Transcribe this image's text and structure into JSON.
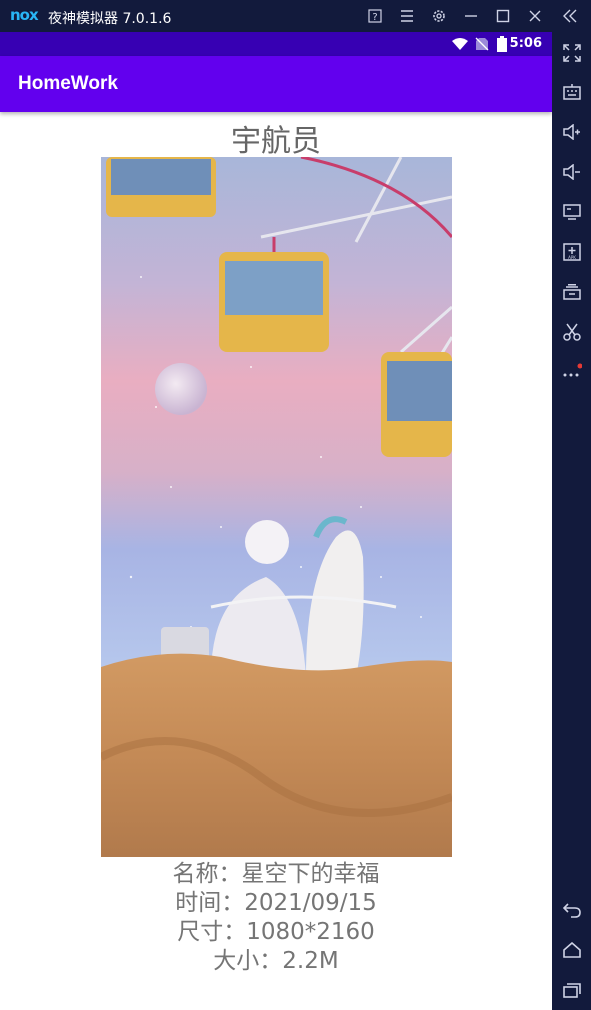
{
  "window": {
    "logo": "nox",
    "title": "夜神模拟器 7.0.1.6",
    "controls": [
      "help-icon",
      "menu-icon",
      "settings-icon",
      "minimize-icon",
      "maximize-icon",
      "close-icon",
      "collapse-icon"
    ]
  },
  "statusbar": {
    "time": "5:06",
    "icons": [
      "wifi-icon",
      "no-sim-icon",
      "battery-icon"
    ]
  },
  "appbar": {
    "title": "HomeWork"
  },
  "content": {
    "picture_title": "宇航员",
    "name_line": "名称：星空下的幸福",
    "time_line": "时间：2021/09/15",
    "size_line": "尺寸：1080*2160",
    "filesize_line": "大小：2.2M"
  },
  "sidebar": {
    "tools": [
      "fullscreen-icon",
      "keyboard-icon",
      "volume-up-icon",
      "volume-down-icon",
      "screen-icon",
      "apk-install-icon",
      "multi-instance-icon",
      "scissors-icon",
      "more-icon",
      "back-icon",
      "home-icon",
      "recent-apps-icon"
    ]
  },
  "colors": {
    "statusbar": "#3700b3",
    "appbar": "#6200ee",
    "emulator_chrome": "#121a3c",
    "info_text": "#757575"
  }
}
